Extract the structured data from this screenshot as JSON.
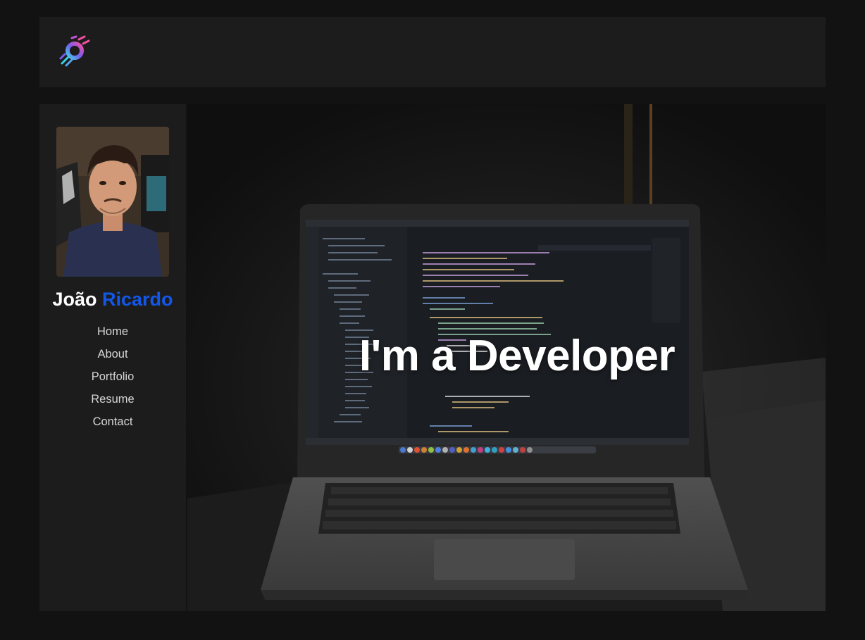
{
  "header": {
    "logo_icon": "swirl-logo-icon"
  },
  "profile": {
    "avatar_icon": "profile-photo",
    "first_name": "João",
    "last_name": "Ricardo",
    "accent_color": "#1357e8"
  },
  "nav": {
    "items": [
      {
        "label": "Home"
      },
      {
        "label": "About"
      },
      {
        "label": "Portfolio"
      },
      {
        "label": "Resume"
      },
      {
        "label": "Contact"
      }
    ]
  },
  "hero": {
    "title": "I'm a Developer",
    "background_icon": "laptop-code-editor-photo"
  }
}
